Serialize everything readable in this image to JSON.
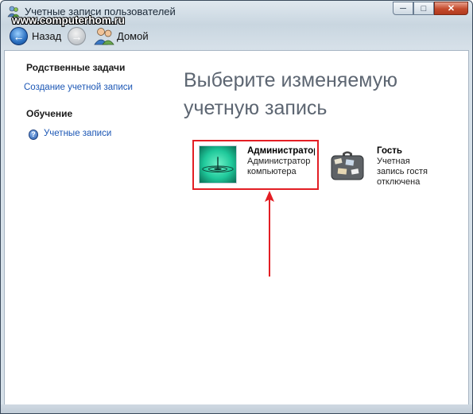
{
  "window": {
    "title": "Учетные записи пользователей",
    "watermark": "www.computerhom.ru",
    "buttons": {
      "minimize": "─",
      "maximize": "□",
      "close": "✕"
    }
  },
  "nav": {
    "back_label": "Назад",
    "home_label": "Домой",
    "icons": {
      "back": "back-arrow",
      "forward": "forward-arrow",
      "home": "users-home"
    }
  },
  "sidebar": {
    "related_tasks_heading": "Родственные задачи",
    "create_account_link": "Создание учетной записи",
    "learning_heading": "Обучение",
    "accounts_help_link": "Учетные записи"
  },
  "main": {
    "heading_line1": "Выберите изменяемую",
    "heading_line2": "учетную запись",
    "accounts": [
      {
        "name": "Администратор",
        "line1": "Администратор",
        "line2": "компьютера"
      },
      {
        "name": "Гость",
        "line1": "Учетная",
        "line2": "запись гостя",
        "line3": "отключена"
      }
    ]
  },
  "colors": {
    "link": "#1c57b5",
    "highlight": "#e31e24",
    "heading": "#5d6672"
  }
}
